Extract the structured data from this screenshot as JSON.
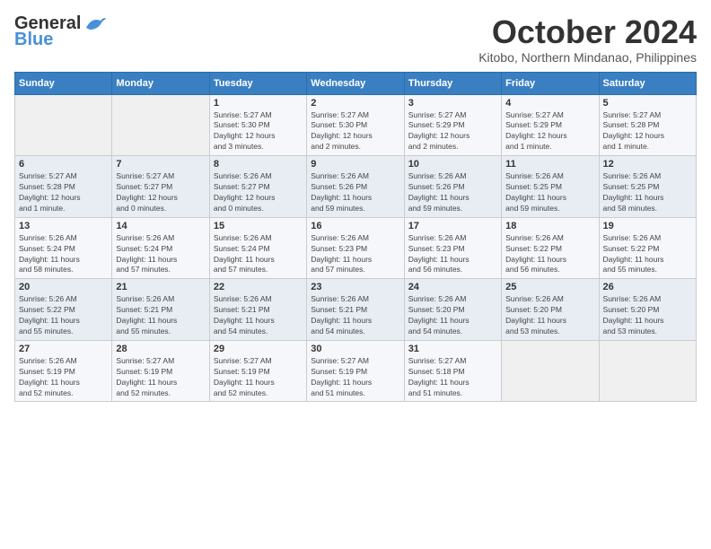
{
  "header": {
    "logo_line1": "General",
    "logo_line2": "Blue",
    "month_title": "October 2024",
    "location": "Kitobo, Northern Mindanao, Philippines"
  },
  "weekdays": [
    "Sunday",
    "Monday",
    "Tuesday",
    "Wednesday",
    "Thursday",
    "Friday",
    "Saturday"
  ],
  "weeks": [
    [
      {
        "day": "",
        "info": ""
      },
      {
        "day": "",
        "info": ""
      },
      {
        "day": "1",
        "info": "Sunrise: 5:27 AM\nSunset: 5:30 PM\nDaylight: 12 hours\nand 3 minutes."
      },
      {
        "day": "2",
        "info": "Sunrise: 5:27 AM\nSunset: 5:30 PM\nDaylight: 12 hours\nand 2 minutes."
      },
      {
        "day": "3",
        "info": "Sunrise: 5:27 AM\nSunset: 5:29 PM\nDaylight: 12 hours\nand 2 minutes."
      },
      {
        "day": "4",
        "info": "Sunrise: 5:27 AM\nSunset: 5:29 PM\nDaylight: 12 hours\nand 1 minute."
      },
      {
        "day": "5",
        "info": "Sunrise: 5:27 AM\nSunset: 5:28 PM\nDaylight: 12 hours\nand 1 minute."
      }
    ],
    [
      {
        "day": "6",
        "info": "Sunrise: 5:27 AM\nSunset: 5:28 PM\nDaylight: 12 hours\nand 1 minute."
      },
      {
        "day": "7",
        "info": "Sunrise: 5:27 AM\nSunset: 5:27 PM\nDaylight: 12 hours\nand 0 minutes."
      },
      {
        "day": "8",
        "info": "Sunrise: 5:26 AM\nSunset: 5:27 PM\nDaylight: 12 hours\nand 0 minutes."
      },
      {
        "day": "9",
        "info": "Sunrise: 5:26 AM\nSunset: 5:26 PM\nDaylight: 11 hours\nand 59 minutes."
      },
      {
        "day": "10",
        "info": "Sunrise: 5:26 AM\nSunset: 5:26 PM\nDaylight: 11 hours\nand 59 minutes."
      },
      {
        "day": "11",
        "info": "Sunrise: 5:26 AM\nSunset: 5:25 PM\nDaylight: 11 hours\nand 59 minutes."
      },
      {
        "day": "12",
        "info": "Sunrise: 5:26 AM\nSunset: 5:25 PM\nDaylight: 11 hours\nand 58 minutes."
      }
    ],
    [
      {
        "day": "13",
        "info": "Sunrise: 5:26 AM\nSunset: 5:24 PM\nDaylight: 11 hours\nand 58 minutes."
      },
      {
        "day": "14",
        "info": "Sunrise: 5:26 AM\nSunset: 5:24 PM\nDaylight: 11 hours\nand 57 minutes."
      },
      {
        "day": "15",
        "info": "Sunrise: 5:26 AM\nSunset: 5:24 PM\nDaylight: 11 hours\nand 57 minutes."
      },
      {
        "day": "16",
        "info": "Sunrise: 5:26 AM\nSunset: 5:23 PM\nDaylight: 11 hours\nand 57 minutes."
      },
      {
        "day": "17",
        "info": "Sunrise: 5:26 AM\nSunset: 5:23 PM\nDaylight: 11 hours\nand 56 minutes."
      },
      {
        "day": "18",
        "info": "Sunrise: 5:26 AM\nSunset: 5:22 PM\nDaylight: 11 hours\nand 56 minutes."
      },
      {
        "day": "19",
        "info": "Sunrise: 5:26 AM\nSunset: 5:22 PM\nDaylight: 11 hours\nand 55 minutes."
      }
    ],
    [
      {
        "day": "20",
        "info": "Sunrise: 5:26 AM\nSunset: 5:22 PM\nDaylight: 11 hours\nand 55 minutes."
      },
      {
        "day": "21",
        "info": "Sunrise: 5:26 AM\nSunset: 5:21 PM\nDaylight: 11 hours\nand 55 minutes."
      },
      {
        "day": "22",
        "info": "Sunrise: 5:26 AM\nSunset: 5:21 PM\nDaylight: 11 hours\nand 54 minutes."
      },
      {
        "day": "23",
        "info": "Sunrise: 5:26 AM\nSunset: 5:21 PM\nDaylight: 11 hours\nand 54 minutes."
      },
      {
        "day": "24",
        "info": "Sunrise: 5:26 AM\nSunset: 5:20 PM\nDaylight: 11 hours\nand 54 minutes."
      },
      {
        "day": "25",
        "info": "Sunrise: 5:26 AM\nSunset: 5:20 PM\nDaylight: 11 hours\nand 53 minutes."
      },
      {
        "day": "26",
        "info": "Sunrise: 5:26 AM\nSunset: 5:20 PM\nDaylight: 11 hours\nand 53 minutes."
      }
    ],
    [
      {
        "day": "27",
        "info": "Sunrise: 5:26 AM\nSunset: 5:19 PM\nDaylight: 11 hours\nand 52 minutes."
      },
      {
        "day": "28",
        "info": "Sunrise: 5:27 AM\nSunset: 5:19 PM\nDaylight: 11 hours\nand 52 minutes."
      },
      {
        "day": "29",
        "info": "Sunrise: 5:27 AM\nSunset: 5:19 PM\nDaylight: 11 hours\nand 52 minutes."
      },
      {
        "day": "30",
        "info": "Sunrise: 5:27 AM\nSunset: 5:19 PM\nDaylight: 11 hours\nand 51 minutes."
      },
      {
        "day": "31",
        "info": "Sunrise: 5:27 AM\nSunset: 5:18 PM\nDaylight: 11 hours\nand 51 minutes."
      },
      {
        "day": "",
        "info": ""
      },
      {
        "day": "",
        "info": ""
      }
    ]
  ]
}
